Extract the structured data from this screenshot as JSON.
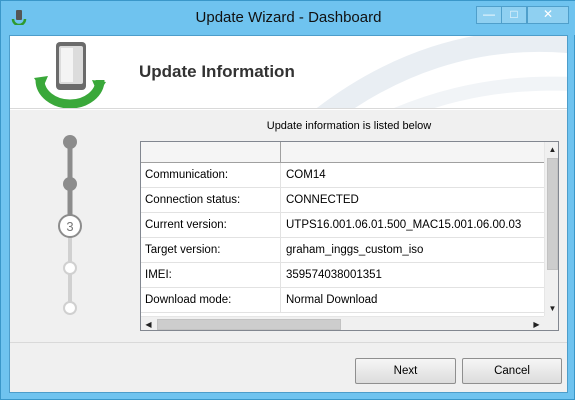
{
  "window": {
    "title": "Update Wizard - Dashboard",
    "controls": {
      "minimize": "—",
      "maximize": "□",
      "close": "✕"
    }
  },
  "header": {
    "title": "Update Information"
  },
  "steps": {
    "current_step": "3",
    "total": 5,
    "completed": 2
  },
  "content": {
    "caption": "Update information is listed below",
    "rows": [
      {
        "label": "Communication:",
        "value": "COM14"
      },
      {
        "label": "Connection status:",
        "value": "CONNECTED"
      },
      {
        "label": "Current version:",
        "value": "UTPS16.001.06.01.500_MAC15.001.06.00.03"
      },
      {
        "label": "Target version:",
        "value": "graham_inggs_custom_iso"
      },
      {
        "label": "IMEI:",
        "value": "359574038001351"
      },
      {
        "label": "Download mode:",
        "value": "Normal Download"
      }
    ]
  },
  "scroll": {
    "up": "▲",
    "down": "▼",
    "left": "◀",
    "right": "▶"
  },
  "buttons": {
    "next": "Next",
    "cancel": "Cancel"
  },
  "colors": {
    "titlebar": "#6fc3ef",
    "step_active": "#8c8c8c",
    "step_inactive": "#d0d0d0",
    "icon_green": "#3aa83a"
  }
}
